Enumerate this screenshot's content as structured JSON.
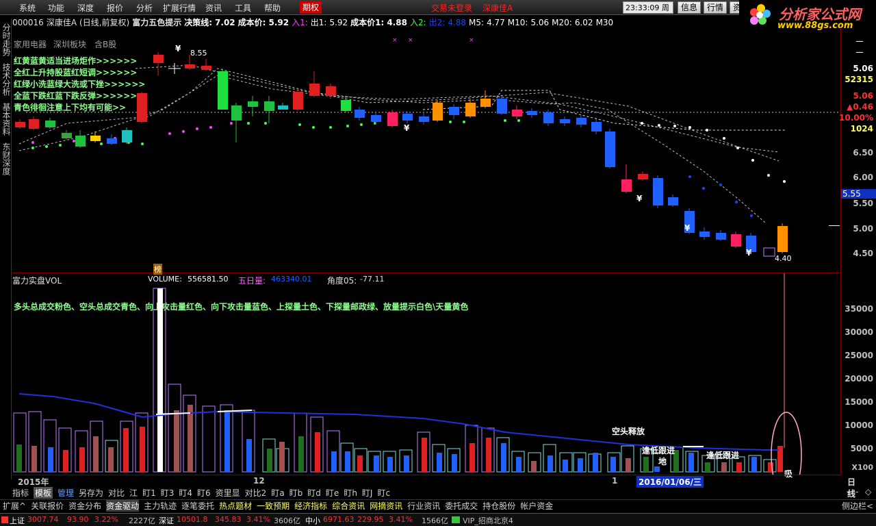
{
  "menu": {
    "items": [
      "系统",
      "功能",
      "深度",
      "报价",
      "分析",
      "扩展行情",
      "资讯",
      "工具",
      "帮助"
    ],
    "options_label": "期权",
    "trade_status": "交易未登录",
    "stock_short": "深康佳A",
    "clock": "23:33:09",
    "weekday": "周二",
    "buttons": [
      "信息",
      "行情",
      "资"
    ]
  },
  "logo": {
    "title": "分析家公式网",
    "url": "www.88gs.com"
  },
  "info": {
    "code": "000016",
    "name": "深康佳A",
    "period": "(日线,前复权)",
    "indicator": "富力五色提示",
    "decision_label": "决策线:",
    "decision_value": "7.02",
    "cost_label": "成本价:",
    "cost_value": "5.92",
    "in1": "入1:",
    "out1": "出1:",
    "out1_value": "5.92",
    "cost2_label": "成本价1:",
    "cost2_value": "4.88",
    "in2": "入2:",
    "out2": "出2:",
    "out2_value": "4.88",
    "m5": "M5:",
    "m5_value": "4.77",
    "m10": "M10:",
    "m10_value": "5.06",
    "m20": "M20:",
    "m20_value": "6.02",
    "m30": "M30"
  },
  "sidebar": {
    "tabs": [
      "分时走势",
      "技术分析",
      "基本资料",
      "东财深度"
    ]
  },
  "categories": [
    "家用电器",
    "深圳板块",
    "含B股"
  ],
  "strategy_lines": [
    "红黄蓝黄适当进场炬作>>>>>>",
    "全红上升持股蓝红短调>>>>>>",
    "红绿小洗蓝绿大洗或下挫>>>>>>",
    "全蓝下跌红蓝下跌反弹>>>>>>",
    "青色徘徊注意上下均有可能>>"
  ],
  "price_axis": {
    "ticks": [
      "5.06",
      "52315",
      "5.06",
      "▲0.46",
      "10.00%",
      "1024",
      "6.50",
      "6.00",
      "5.55",
      "5.50",
      "5.00",
      "4.50"
    ],
    "current": "5.55"
  },
  "annotations": {
    "high": "8.55",
    "low": "4.40",
    "yen": "¥",
    "bang": "榜",
    "kongtou": "空头释放",
    "zhuidi1": "逢低跟进",
    "zhuidi2": "逢低跟进",
    "di": "地",
    "xi": "吸"
  },
  "volume": {
    "title": "富力实盘VOL",
    "volume_label": "VOLUME:",
    "volume_value": "556581.50",
    "ma5_label": "五日量:",
    "ma5_value": "463340.01",
    "angle_label": "角度05:",
    "angle_value": "-77.11",
    "legend": "多头总成交粉色、空头总成交青色、向上攻击量红色、向下攻击量蓝色、上探量土色、下探量邮政绿、放量提示白色\\天量黄色",
    "axis": [
      "35000",
      "30000",
      "25000",
      "20000",
      "15000",
      "10000",
      "5000",
      "X100"
    ],
    "unit": "X100"
  },
  "xaxis": {
    "year": "2015年",
    "month12": "12",
    "month1": "1",
    "cursor_date": "2016/01/06/三",
    "period": "日线"
  },
  "tabbar1": [
    "指标",
    "模板",
    "管理",
    "另存为",
    "对比",
    "江",
    "盯1",
    "盯3",
    "盯4",
    "盯6",
    "资里显",
    "对比2",
    "盯a",
    "盯b",
    "盯d",
    "盯e",
    "盯h",
    "盯J",
    "盯c"
  ],
  "tabbar1_right": [
    "+",
    "-",
    "◇"
  ],
  "tabbar2": [
    "扩展^",
    "关联报价",
    "资金分布",
    "资金驱动",
    "主力轨迹",
    "逐笔委托",
    "热点题材",
    "一致预期",
    "经济指标",
    "综合资讯",
    "网摘资讯",
    "行业资讯",
    "委托成交",
    "持仓股份",
    "帐户资金"
  ],
  "tabbar2_right": "侧边栏<",
  "status": {
    "sh_label": "上证",
    "sh_value": "3007.74",
    "sh_change": "93.90",
    "sh_pct": "3.22%",
    "sh_amount": "2227亿",
    "sz_label": "深证",
    "sz_value": "10501.8",
    "sz_change": "345.83",
    "sz_pct": "3.41%",
    "sz_amount": "3606亿",
    "zx_label": "中小",
    "zx_value": "6971.63",
    "zx_change": "229.95",
    "zx_pct": "3.41%",
    "zx_amount": "1566亿",
    "server": "VIP_招商北京4"
  },
  "colors": {
    "up": "#ff3030",
    "down": "#00c0ff",
    "ma_line": "#2040ff",
    "border": "#800000",
    "yellow": "#ffff00"
  }
}
